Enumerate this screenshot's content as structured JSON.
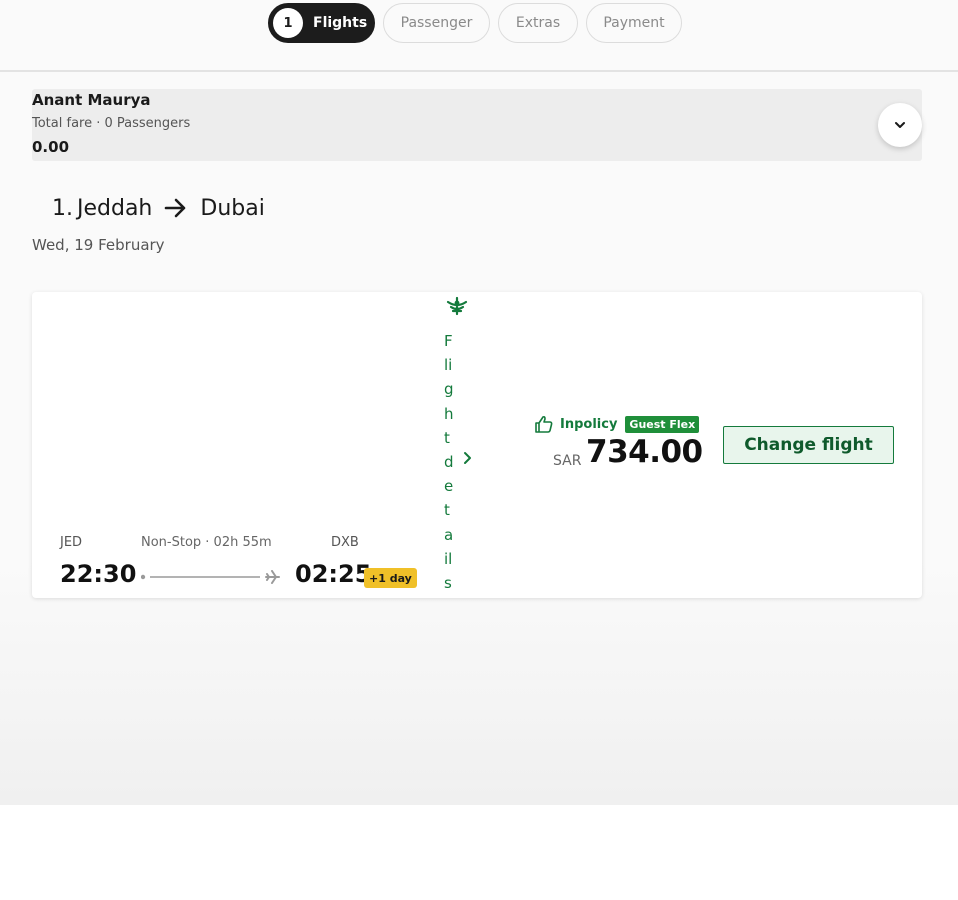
{
  "stepper": {
    "steps": [
      {
        "num": "1",
        "label": "Flights",
        "active": true
      },
      {
        "label": "Passenger"
      },
      {
        "label": "Extras"
      },
      {
        "label": "Payment"
      }
    ]
  },
  "summary": {
    "name": "Anant Maurya",
    "fare_label": "Total fare · 0 Passengers",
    "fare_value": "0.00",
    "expand_icon": "chevron-down-icon"
  },
  "route": {
    "prefix": "1.",
    "from_city": "Jeddah",
    "to_city": "Dubai",
    "date": "Wed, 19 February"
  },
  "flight": {
    "dep_code": "JED",
    "dep_time": "22:30",
    "duration": "Non-Stop · 02h 55m",
    "arr_code": "DXB",
    "arr_time": "02:25",
    "day_offset": "+1 day",
    "details_link": "Flight details",
    "policy": "Inpolicy",
    "fare_brand": "Guest Flex",
    "currency": "SAR",
    "price": "734.00",
    "change_button": "Change flight"
  },
  "colors": {
    "accent_green": "#147a3c",
    "badge_yellow": "#f0c028",
    "active_step": "#1c1c1c"
  }
}
